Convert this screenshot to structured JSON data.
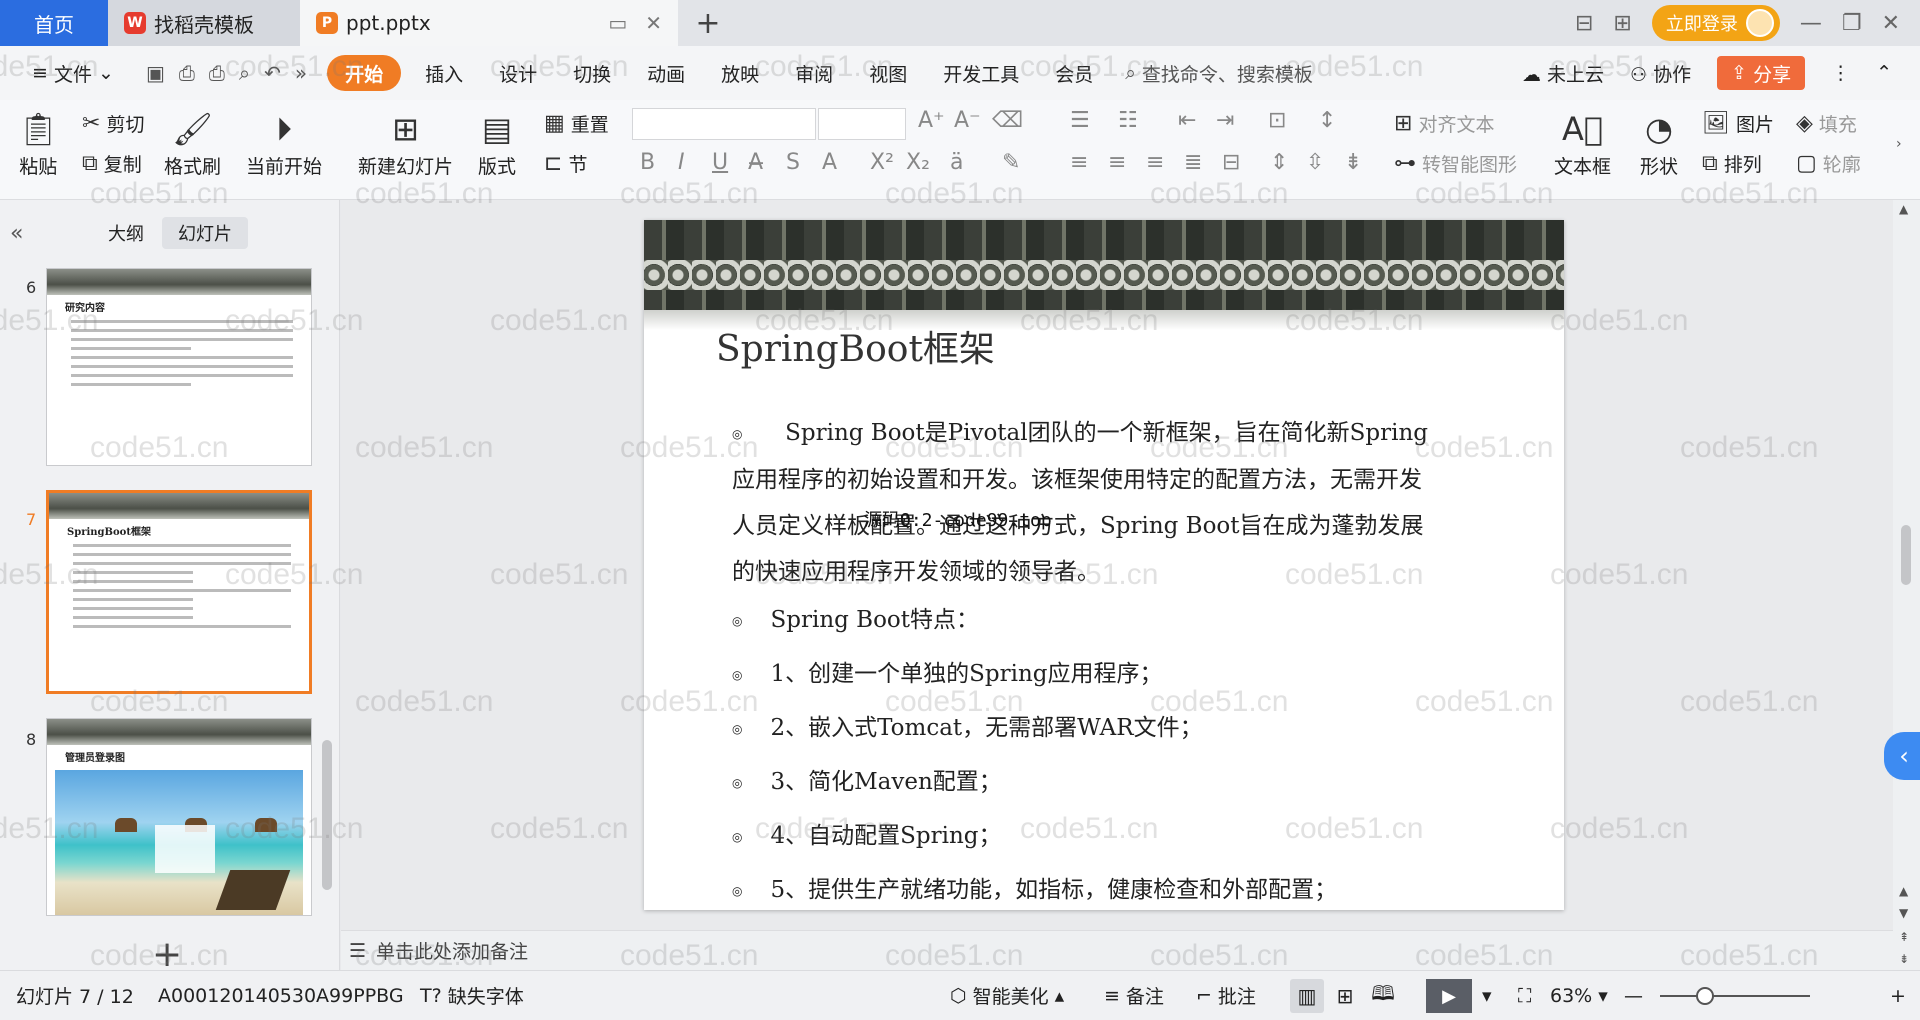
{
  "tabs": {
    "home": "首页",
    "template": "找稻壳模板",
    "document": "ppt.pptx",
    "new_tab_icon": "plus-icon"
  },
  "title_right": {
    "login": "立即登录"
  },
  "menu": {
    "file": "文件",
    "items": [
      "开始",
      "插入",
      "设计",
      "切换",
      "动画",
      "放映",
      "审阅",
      "视图",
      "开发工具",
      "会员"
    ],
    "active": "开始",
    "search": "查找命令、搜索模板",
    "cloud": "未上云",
    "collab": "协作",
    "share": "分享"
  },
  "ribbon": {
    "paste": "粘贴",
    "cut": "剪切",
    "copy": "复制",
    "format_painter": "格式刷",
    "from_current": "当前开始",
    "new_slide": "新建幻灯片",
    "layout": "版式",
    "reset": "重置",
    "section": "节",
    "align_text": "对齐文本",
    "smartart": "转智能图形",
    "textbox": "文本框",
    "shape": "形状",
    "picture": "图片",
    "fill": "填充",
    "arrange": "排列",
    "outline": "轮廓"
  },
  "left_panel": {
    "outline_tab": "大纲",
    "slides_tab": "幻灯片",
    "thumbs": [
      {
        "num": "6",
        "title": "研究内容"
      },
      {
        "num": "7",
        "title": "SpringBoot框架"
      },
      {
        "num": "8",
        "title": "管理员登录图"
      }
    ]
  },
  "slide": {
    "title": "SpringBoot框架",
    "paragraph_lines": [
      "Spring Boot是Pivotal团队的一个新框架，旨在简化新Spring",
      "应用程序的初始设置和开发。该框架使用特定的配置方法，无需开发",
      "人员定义样板配置。通过这种方式，Spring Boot旨在成为蓬勃发展",
      "的快速应用程序开发领域的领导者。"
    ],
    "bullets": [
      "Spring Boot特点：",
      "1、创建一个单独的Spring应用程序；",
      "2、嵌入式Tomcat，无需部署WAR文件；",
      "3、简化Maven配置；",
      "4、自动配置Spring；",
      "5、提供生产就绪功能，如指标，健康检查和外部配置；"
    ],
    "overlay_text": "源码Q:2-code99.top",
    "bullet_glyph": "◎"
  },
  "notes": {
    "placeholder": "单击此处添加备注"
  },
  "status": {
    "slide_counter": "幻灯片 7 / 12",
    "doc_id": "A000120140530A99PPBG",
    "missing_font": "缺失字体",
    "beautify": "智能美化",
    "notes": "备注",
    "comments": "批注",
    "zoom": "63%",
    "zoom_level": 0.63
  },
  "watermark": "code51.cn",
  "colors": {
    "accent": "#f07c24",
    "home_tab": "#2b6de0",
    "login": "#f3a415",
    "share": "#f06b3b"
  }
}
